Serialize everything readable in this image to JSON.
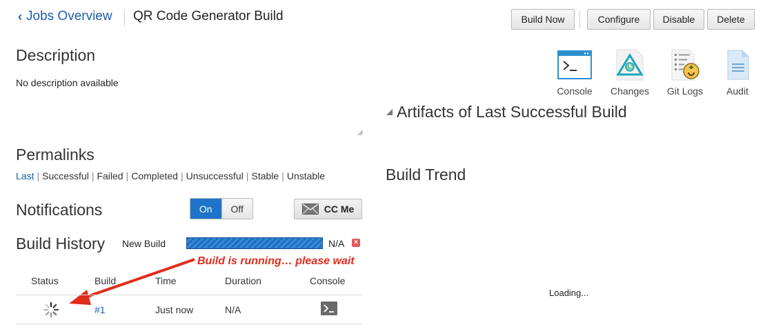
{
  "header": {
    "back_label": "Jobs Overview",
    "job_title": "QR Code Generator Build",
    "buttons": {
      "build_now": "Build Now",
      "configure": "Configure",
      "disable": "Disable",
      "delete": "Delete"
    }
  },
  "description": {
    "title": "Description",
    "text": "No description available"
  },
  "permalinks": {
    "title": "Permalinks",
    "links": [
      "Last",
      "Successful",
      "Failed",
      "Completed",
      "Unsuccessful",
      "Stable",
      "Unstable"
    ],
    "separator": "|"
  },
  "notifications": {
    "title": "Notifications",
    "on_label": "On",
    "off_label": "Off",
    "selected": "On",
    "cc_me_label": "CC Me"
  },
  "build_history": {
    "title": "Build History",
    "new_build_label": "New Build",
    "progress_value": "N/A",
    "annotation": "Build is running… please wait",
    "columns": [
      "Status",
      "Build",
      "Time",
      "Duration",
      "Console"
    ],
    "rows": [
      {
        "status": "running",
        "build": "#1",
        "time": "Just now",
        "duration": "N/A",
        "console": "console-icon"
      }
    ]
  },
  "tools": [
    {
      "label": "Console",
      "icon": "console-icon"
    },
    {
      "label": "Changes",
      "icon": "changes-icon"
    },
    {
      "label": "Git Logs",
      "icon": "git-logs-icon"
    },
    {
      "label": "Audit",
      "icon": "audit-icon"
    }
  ],
  "artifacts": {
    "title": "Artifacts of Last Successful Build"
  },
  "build_trend": {
    "title": "Build Trend",
    "loading_text": "Loading..."
  },
  "colors": {
    "link": "#1a5ea8",
    "toggle_on": "#1f73c9",
    "annotation": "#e02c1c",
    "progress": "#1f6fc2"
  }
}
